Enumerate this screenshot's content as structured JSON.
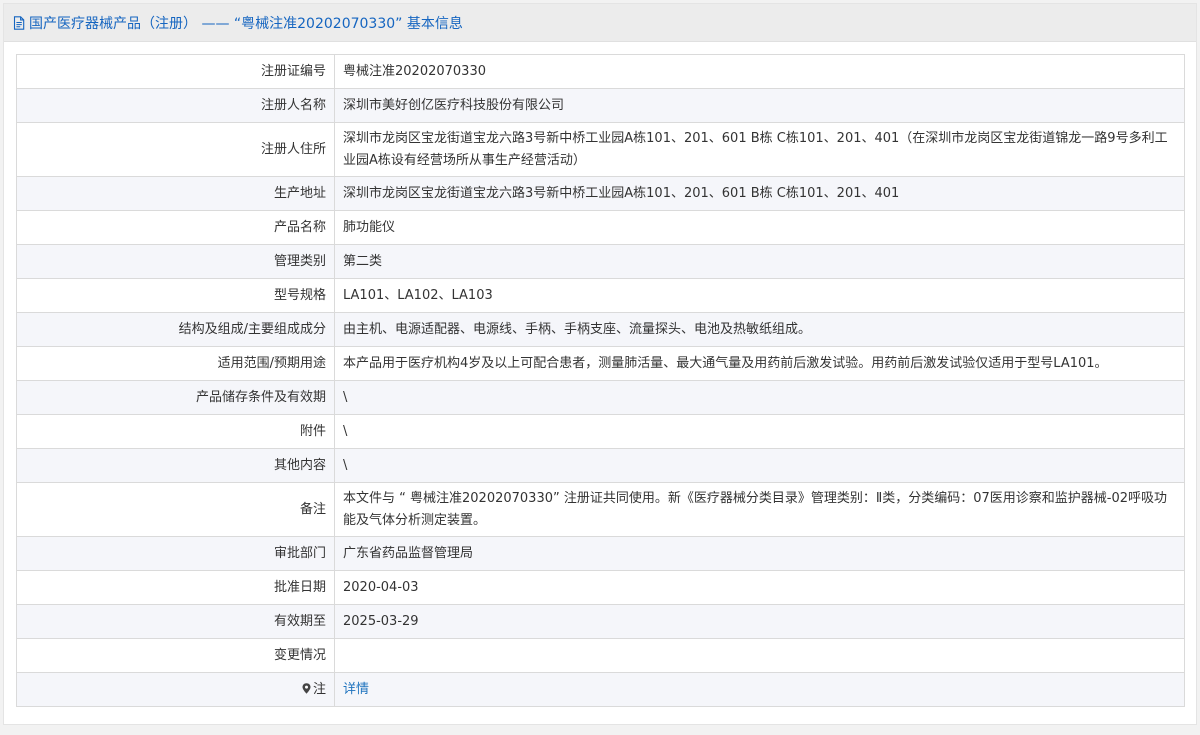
{
  "header": {
    "title": "国产医疗器械产品（注册） —— “粤械注准20202070330” 基本信息"
  },
  "rows": [
    {
      "label": "注册证编号",
      "value": "粤械注准20202070330"
    },
    {
      "label": "注册人名称",
      "value": "深圳市美好创亿医疗科技股份有限公司"
    },
    {
      "label": "注册人住所",
      "value": "深圳市龙岗区宝龙街道宝龙六路3号新中桥工业园A栋101、201、601 B栋 C栋101、201、401（在深圳市龙岗区宝龙街道锦龙一路9号多利工业园A栋设有经营场所从事生产经营活动）"
    },
    {
      "label": "生产地址",
      "value": "深圳市龙岗区宝龙街道宝龙六路3号新中桥工业园A栋101、201、601 B栋 C栋101、201、401"
    },
    {
      "label": "产品名称",
      "value": "肺功能仪"
    },
    {
      "label": "管理类别",
      "value": "第二类"
    },
    {
      "label": "型号规格",
      "value": "LA101、LA102、LA103"
    },
    {
      "label": "结构及组成/主要组成成分",
      "value": "由主机、电源适配器、电源线、手柄、手柄支座、流量探头、电池及热敏纸组成。"
    },
    {
      "label": "适用范围/预期用途",
      "value": "本产品用于医疗机构4岁及以上可配合患者，测量肺活量、最大通气量及用药前后激发试验。用药前后激发试验仅适用于型号LA101。"
    },
    {
      "label": "产品储存条件及有效期",
      "value": "\\"
    },
    {
      "label": "附件",
      "value": "\\"
    },
    {
      "label": "其他内容",
      "value": "\\"
    },
    {
      "label": "备注",
      "value": "本文件与 “ 粤械注准20202070330” 注册证共同使用。新《医疗器械分类目录》管理类别：Ⅱ类，分类编码：07医用诊察和监护器械-02呼吸功能及气体分析测定装置。"
    },
    {
      "label": "审批部门",
      "value": "广东省药品监督管理局"
    },
    {
      "label": "批准日期",
      "value": "2020-04-03"
    },
    {
      "label": "有效期至",
      "value": "2025-03-29"
    },
    {
      "label": "变更情况",
      "value": ""
    }
  ],
  "note_row": {
    "label": "注",
    "icon": "map-pin-icon",
    "link_text": "详情"
  },
  "colors": {
    "header_text": "#1565c0",
    "link": "#1e73be",
    "alt_row": "#f5f6fa"
  }
}
